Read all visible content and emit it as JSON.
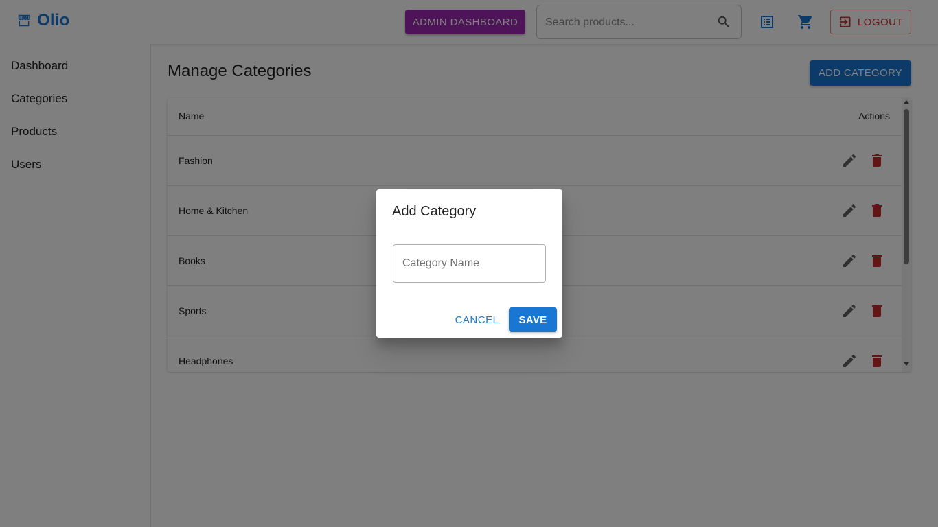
{
  "header": {
    "logo_text": "Olio",
    "admin_button": "ADMIN DASHBOARD",
    "search_placeholder": "Search products...",
    "logout_label": "LOGOUT",
    "icons": [
      "store-icon",
      "search-icon",
      "orders-list-icon",
      "cart-icon",
      "logout-icon"
    ],
    "colors": {
      "brand": "#1976d2",
      "admin": "#9c27b0",
      "logout": "#d32f2f"
    }
  },
  "sidebar": {
    "items": [
      {
        "label": "Dashboard"
      },
      {
        "label": "Categories"
      },
      {
        "label": "Products"
      },
      {
        "label": "Users"
      }
    ]
  },
  "main": {
    "title": "Manage Categories",
    "add_button": "ADD CATEGORY",
    "table": {
      "columns": [
        "Name",
        "Actions"
      ],
      "rows": [
        {
          "name": "Fashion"
        },
        {
          "name": "Home & Kitchen"
        },
        {
          "name": "Books"
        },
        {
          "name": "Sports"
        },
        {
          "name": "Headphones"
        }
      ],
      "row_icons": [
        "edit-icon",
        "delete-icon"
      ],
      "colors": {
        "edit": "#616161",
        "delete": "#c62828"
      }
    }
  },
  "dialog": {
    "title": "Add Category",
    "input_placeholder": "Category Name",
    "input_value": "",
    "cancel_label": "CANCEL",
    "save_label": "SAVE"
  }
}
